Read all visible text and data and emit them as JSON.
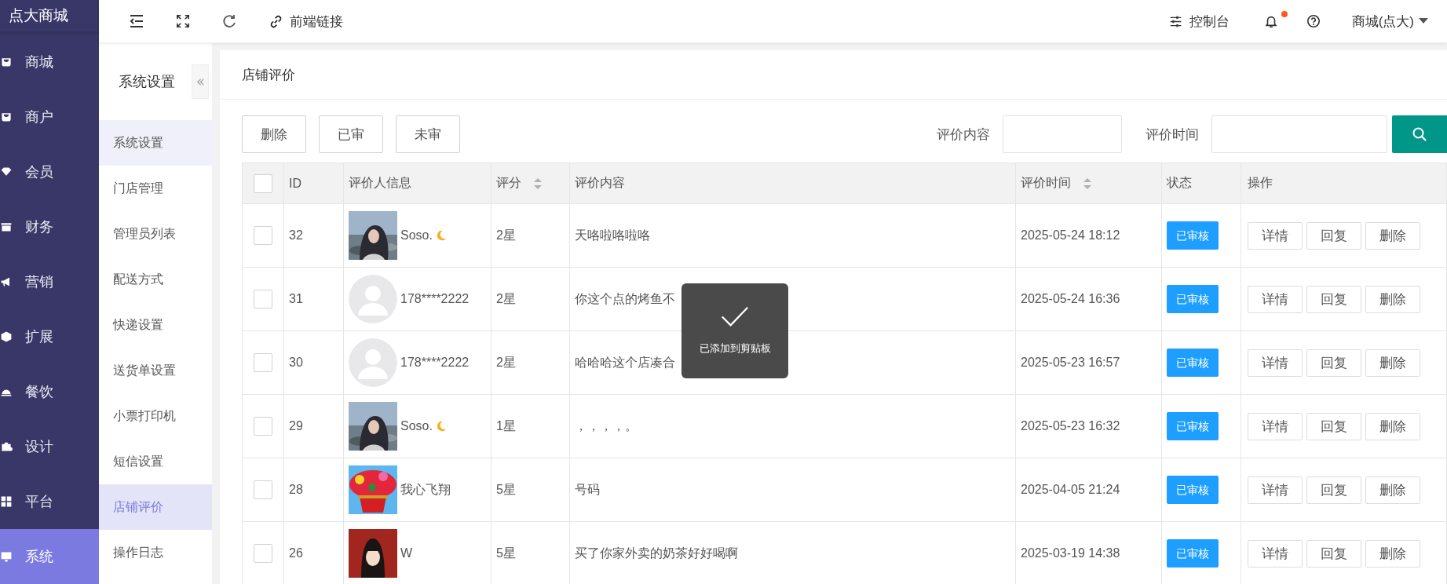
{
  "brand": "点大商城",
  "sidebar": {
    "items": [
      {
        "label": "商城",
        "selected": false
      },
      {
        "label": "商户",
        "selected": false
      },
      {
        "label": "会员",
        "selected": false
      },
      {
        "label": "财务",
        "selected": false
      },
      {
        "label": "营销",
        "selected": false
      },
      {
        "label": "扩展",
        "selected": false
      },
      {
        "label": "餐饮",
        "selected": false
      },
      {
        "label": "设计",
        "selected": false
      },
      {
        "label": "平台",
        "selected": false
      },
      {
        "label": "系统",
        "selected": true
      }
    ]
  },
  "topbar": {
    "link": "前端链接",
    "console": "控制台",
    "notification_dot": true,
    "user": "商城(点大)"
  },
  "submenu": {
    "title": "系统设置",
    "items": [
      {
        "label": "系统设置",
        "selected": false,
        "hovered": true
      },
      {
        "label": "门店管理",
        "selected": false,
        "hovered": false
      },
      {
        "label": "管理员列表",
        "selected": false,
        "hovered": false
      },
      {
        "label": "配送方式",
        "selected": false,
        "hovered": false
      },
      {
        "label": "快递设置",
        "selected": false,
        "hovered": false
      },
      {
        "label": "送货单设置",
        "selected": false,
        "hovered": false
      },
      {
        "label": "小票打印机",
        "selected": false,
        "hovered": false
      },
      {
        "label": "短信设置",
        "selected": false,
        "hovered": false
      },
      {
        "label": "店铺评价",
        "selected": true,
        "hovered": false
      },
      {
        "label": "操作日志",
        "selected": false,
        "hovered": false
      }
    ]
  },
  "page_title": "店铺评价",
  "toolbar": {
    "buttons": [
      "删除",
      "已审",
      "未审"
    ],
    "filters": [
      {
        "label": "评价内容"
      },
      {
        "label": "评价时间"
      }
    ]
  },
  "table": {
    "all_checked": false,
    "columns": [
      {
        "label": "ID",
        "sortable": false
      },
      {
        "label": "评价人信息",
        "sortable": false
      },
      {
        "label": "评分",
        "sortable": true
      },
      {
        "label": "评价内容",
        "sortable": false
      },
      {
        "label": "评价时间",
        "sortable": true
      },
      {
        "label": "状态",
        "sortable": false
      },
      {
        "label": "操作",
        "sortable": false
      }
    ],
    "rows": [
      {
        "id": "32",
        "name": "Soso.",
        "moon": true,
        "rating": "2星",
        "content": "天咯啦咯啦咯",
        "time": "2025-05-24 18:12",
        "status": "已审核",
        "checked": false,
        "actions": [
          "详情",
          "回复",
          "删除"
        ]
      },
      {
        "id": "31",
        "avatar": {
          "kind": "default"
        },
        "name": "178****2222",
        "moon": false,
        "rating": "2星",
        "content": "你这个点的烤鱼不",
        "time": "2025-05-24 16:36",
        "status": "已审核",
        "checked": false,
        "actions": [
          "详情",
          "回复",
          "删除"
        ]
      },
      {
        "id": "30",
        "avatar": {
          "kind": "default"
        },
        "name": "178****2222",
        "moon": false,
        "rating": "2星",
        "content": "哈哈哈这个店凑合",
        "time": "2025-05-23 16:57",
        "status": "已审核",
        "checked": false,
        "actions": [
          "详情",
          "回复",
          "删除"
        ]
      },
      {
        "id": "29",
        "name": "Soso.",
        "moon": true,
        "rating": "1星",
        "content": "，，，，。",
        "time": "2025-05-23 16:32",
        "status": "已审核",
        "checked": false,
        "actions": [
          "详情",
          "回复",
          "删除"
        ]
      },
      {
        "id": "28",
        "name": "我心飞翔",
        "moon": false,
        "rating": "5星",
        "content": "号码",
        "time": "2025-04-05 21:24",
        "status": "已审核",
        "checked": false,
        "actions": [
          "详情",
          "回复",
          "删除"
        ]
      },
      {
        "id": "26",
        "name": "W",
        "moon": false,
        "rating": "5星",
        "content": "买了你家外卖的奶茶好好喝啊",
        "time": "2025-03-19 14:38",
        "status": "已审核",
        "checked": false,
        "actions": [
          "详情",
          "回复",
          "删除"
        ]
      }
    ]
  },
  "toast": {
    "message": "已添加到剪贴板"
  }
}
